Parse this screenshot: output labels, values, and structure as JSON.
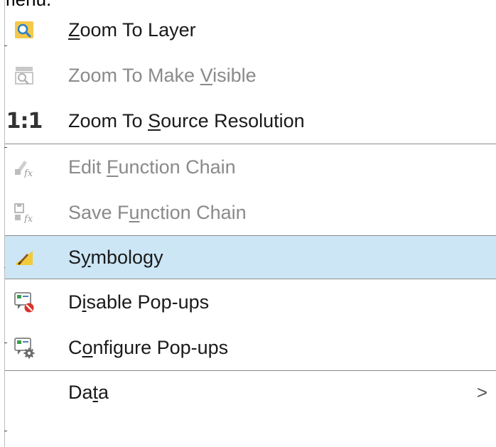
{
  "header": {
    "cut_title": "menu."
  },
  "menu": {
    "items": [
      {
        "label_pre": "",
        "label_accel": "Z",
        "label_post": "oom To Layer",
        "icon": "zoom-to-layer-icon",
        "enabled": true,
        "selected": false
      },
      {
        "label_pre": "Zoom To Make ",
        "label_accel": "V",
        "label_post": "isible",
        "icon": "zoom-to-visible-icon",
        "enabled": false,
        "selected": false
      },
      {
        "label_pre": "Zoom To ",
        "label_accel": "S",
        "label_post": "ource Resolution",
        "icon": "one-to-one-icon",
        "icon_text": "1:1",
        "enabled": true,
        "selected": false
      },
      {
        "label_pre": "Edit ",
        "label_accel": "F",
        "label_post": "unction Chain",
        "icon": "edit-function-chain-icon",
        "enabled": false,
        "selected": false
      },
      {
        "label_pre": "Save F",
        "label_accel": "u",
        "label_post": "nction Chain",
        "icon": "save-function-chain-icon",
        "enabled": false,
        "selected": false
      },
      {
        "label_pre": "S",
        "label_accel": "y",
        "label_post": "mbology",
        "icon": "symbology-brush-icon",
        "enabled": true,
        "selected": true
      },
      {
        "label_pre": "D",
        "label_accel": "i",
        "label_post": "sable Pop-ups",
        "icon": "disable-popups-icon",
        "enabled": true,
        "selected": false
      },
      {
        "label_pre": "C",
        "label_accel": "o",
        "label_post": "nfigure Pop-ups",
        "icon": "configure-popups-icon",
        "enabled": true,
        "selected": false
      },
      {
        "label_pre": "Da",
        "label_accel": "t",
        "label_post": "a",
        "icon": "",
        "enabled": true,
        "selected": false,
        "submenu_glyph": ">"
      }
    ]
  },
  "colors": {
    "selected_bg": "#cce6f6",
    "disabled_text": "#8a8a8a",
    "separator": "#8c8c8c"
  }
}
